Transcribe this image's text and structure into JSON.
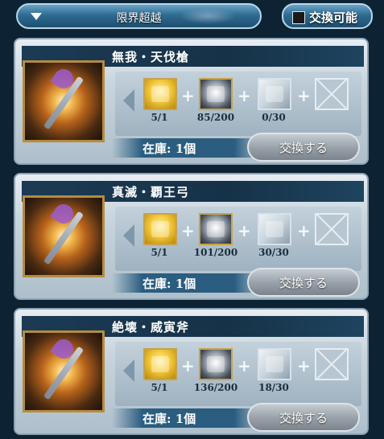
{
  "header": {
    "dropdown_label": "限界超越",
    "toggle_label": "交換可能"
  },
  "cards": [
    {
      "title": "無我・天伐槍",
      "materials": [
        {
          "type": "gold",
          "count": "5/1"
        },
        {
          "type": "shield",
          "count": "85/200"
        },
        {
          "type": "weapon",
          "count": "0/30"
        },
        {
          "type": "empty",
          "count": ""
        }
      ],
      "stock": "在庫: 1個",
      "button": "交換する"
    },
    {
      "title": "真滅・覇王弓",
      "materials": [
        {
          "type": "gold",
          "count": "5/1"
        },
        {
          "type": "shield",
          "count": "101/200"
        },
        {
          "type": "weapon",
          "count": "30/30"
        },
        {
          "type": "empty",
          "count": ""
        }
      ],
      "stock": "在庫: 1個",
      "button": "交換する"
    },
    {
      "title": "絶壊・威寅斧",
      "materials": [
        {
          "type": "gold",
          "count": "5/1"
        },
        {
          "type": "shield",
          "count": "136/200"
        },
        {
          "type": "weapon",
          "count": "18/30"
        },
        {
          "type": "empty",
          "count": ""
        }
      ],
      "stock": "在庫: 1個",
      "button": "交換する"
    }
  ],
  "colors": {
    "background": "#0d2233",
    "titlebar": "#163247",
    "accent_blue": "#2f6c92",
    "frame_gold": "#b68b3e"
  },
  "icons": {
    "dropdown": "triangle-down-icon",
    "toggle": "checkbox-icon",
    "prev": "arrow-left-icon",
    "plus": "plus-icon",
    "empty_slot": "empty-slot-icon"
  }
}
